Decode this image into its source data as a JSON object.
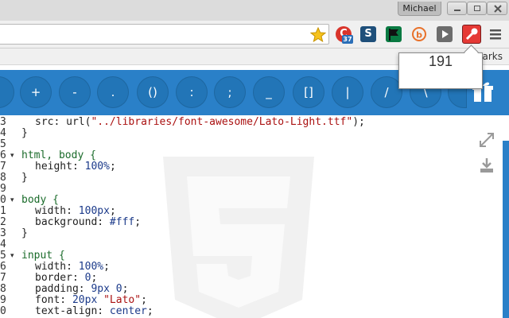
{
  "window": {
    "user": "Michael"
  },
  "toolbar": {
    "extensions": [
      {
        "name": "red-c-extension",
        "badge": "37",
        "color": "#d9342b"
      },
      {
        "name": "s-extension",
        "color": "#1e4f7a"
      },
      {
        "name": "flag-extension",
        "color": "#0a7a42"
      },
      {
        "name": "b-extension",
        "color": "#e8712a"
      },
      {
        "name": "play-extension",
        "color": "#6c6c6c"
      },
      {
        "name": "color-picker-extension",
        "color": "#e53935"
      }
    ],
    "bookmarks_label": "arks"
  },
  "popup": {
    "value": "191"
  },
  "keybar": {
    "keys": [
      "+",
      "-",
      ".",
      "()",
      ":",
      ";",
      "_",
      "[]",
      "|",
      "/",
      "\\"
    ]
  },
  "editor": {
    "lines": [
      {
        "num": "3",
        "fold": ""
      },
      {
        "num": "4",
        "fold": ""
      },
      {
        "num": "5",
        "fold": ""
      },
      {
        "num": "6",
        "fold": "▾"
      },
      {
        "num": "7",
        "fold": ""
      },
      {
        "num": "8",
        "fold": ""
      },
      {
        "num": "9",
        "fold": ""
      },
      {
        "num": "0",
        "fold": "▾"
      },
      {
        "num": "1",
        "fold": ""
      },
      {
        "num": "2",
        "fold": ""
      },
      {
        "num": "3",
        "fold": ""
      },
      {
        "num": "4",
        "fold": ""
      },
      {
        "num": "5",
        "fold": "▾"
      },
      {
        "num": "6",
        "fold": ""
      },
      {
        "num": "7",
        "fold": ""
      },
      {
        "num": "8",
        "fold": ""
      },
      {
        "num": "9",
        "fold": ""
      },
      {
        "num": "0",
        "fold": ""
      }
    ],
    "code": {
      "l0_prop": "src: ",
      "l0_fn": "url(",
      "l0_str": "\"../libraries/font-awesome/Lato-Light.ttf\"",
      "l0_end": ");",
      "l1": "}",
      "l3_sel": "html, body {",
      "l4_prop": "height: ",
      "l4_val": "100%",
      "l4_end": ";",
      "l5": "}",
      "l7_sel": "body {",
      "l8_prop": "width: ",
      "l8_val": "100px",
      "l8_end": ";",
      "l9_prop": "background: ",
      "l9_val": "#fff",
      "l9_end": ";",
      "l10": "}",
      "l12_sel": "input {",
      "l13_prop": "width: ",
      "l13_val": "100%",
      "l13_end": ";",
      "l14_prop": "border: ",
      "l14_val": "0",
      "l14_end": ";",
      "l15_prop": "padding: ",
      "l15_val": "9px 0",
      "l15_end": ";",
      "l16_prop": "font: ",
      "l16_val": "20px ",
      "l16_str": "\"Lato\"",
      "l16_end": ";",
      "l17_prop": "text-align: ",
      "l17_val": "center",
      "l17_end": ";"
    }
  },
  "colors": {
    "accent_blue": "#2a80c8",
    "selector_green": "#1a6b2a",
    "string_red": "#a11"
  }
}
